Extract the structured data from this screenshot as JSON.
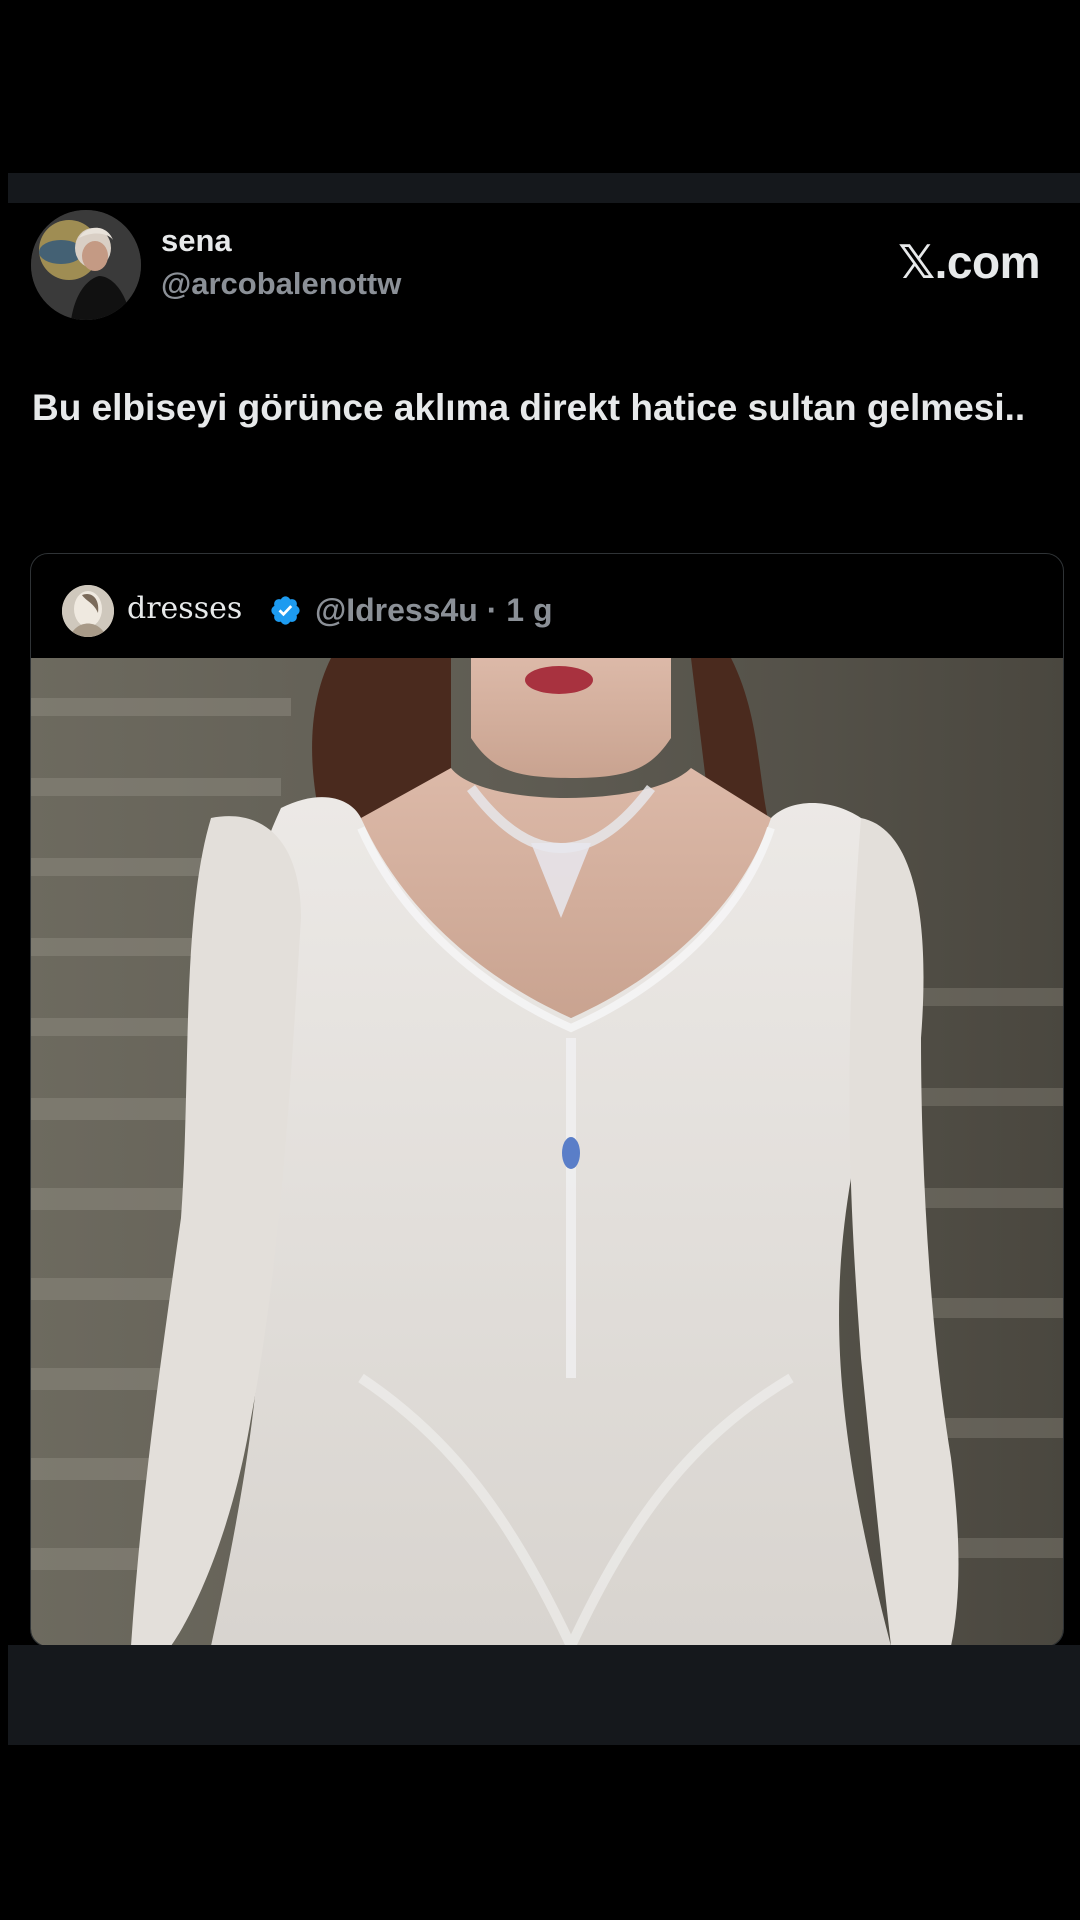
{
  "author": {
    "display_name": "sena",
    "handle": "@arcobalenottw"
  },
  "brand": {
    "label": "𝕏.com"
  },
  "post": {
    "text": "Bu elbiseyi görünce aklıma direkt hatice sultan gelmesi.."
  },
  "quoted_post": {
    "display_name": "dresses",
    "verified": true,
    "handle_and_time": "@Idress4u · 1 g"
  },
  "colors": {
    "background": "#000000",
    "text_primary": "#e7e9ea",
    "text_secondary": "#8b9097",
    "verified_badge": "#1d9bf0",
    "border": "#2f3336"
  },
  "icons": {
    "verified": "verified-badge-icon"
  }
}
